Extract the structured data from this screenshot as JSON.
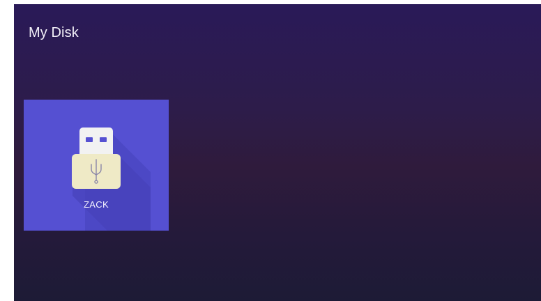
{
  "page": {
    "title": "My Disk"
  },
  "devices": [
    {
      "label": "ZACK",
      "icon": "usb-drive-icon",
      "tile_color": "#5550d2"
    }
  ],
  "colors": {
    "background_top": "#2a1a58",
    "background_bottom": "#1d1b36",
    "tile": "#5550d2",
    "usb_body": "#efeac6",
    "usb_connector": "#f2f2f2"
  }
}
